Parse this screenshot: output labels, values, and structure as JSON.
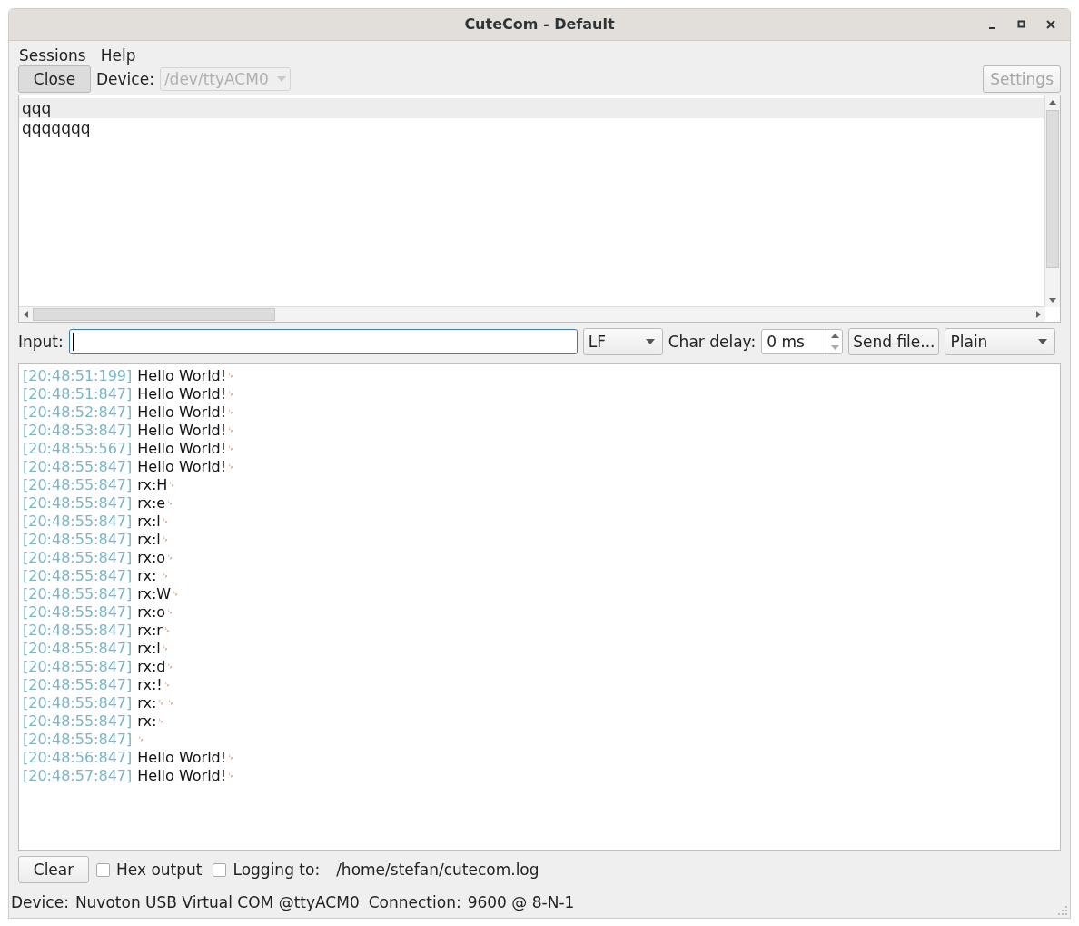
{
  "window": {
    "title": "CuteCom - Default"
  },
  "menu": [
    "Sessions",
    "Help"
  ],
  "toolbar": {
    "close_button": "Close",
    "device_label": "Device:",
    "device": {
      "value": "/dev/ttyACM0",
      "disabled": true
    },
    "settings_button": {
      "label": "Settings",
      "disabled": true
    }
  },
  "history": {
    "lines": [
      {
        "text": "qqq",
        "selected": true
      },
      {
        "text": "qqqqqqq",
        "selected": false
      }
    ]
  },
  "input_bar": {
    "label": "Input:",
    "line_end": "LF",
    "char_delay_label": "Char delay:",
    "char_delay": "0 ms",
    "send_file_button": "Send file...",
    "format": "Plain"
  },
  "log": [
    {
      "time": "[20:48:51:199]",
      "text": "Hello World!",
      "marks": "␊"
    },
    {
      "time": "[20:48:51:847]",
      "text": "Hello World!",
      "marks": "␊"
    },
    {
      "time": "[20:48:52:847]",
      "text": "Hello World!",
      "marks": "␊"
    },
    {
      "time": "[20:48:53:847]",
      "text": "Hello World!",
      "marks": "␊"
    },
    {
      "time": "[20:48:55:567]",
      "text": "Hello World!",
      "marks": "␊"
    },
    {
      "time": "[20:48:55:847]",
      "text": "Hello World!",
      "marks": "␊"
    },
    {
      "time": "[20:48:55:847]",
      "text": "rx:H",
      "marks": "␊"
    },
    {
      "time": "[20:48:55:847]",
      "text": "rx:e",
      "marks": "␊"
    },
    {
      "time": "[20:48:55:847]",
      "text": "rx:l",
      "marks": "␊"
    },
    {
      "time": "[20:48:55:847]",
      "text": "rx:l",
      "marks": "␊"
    },
    {
      "time": "[20:48:55:847]",
      "text": "rx:o",
      "marks": "␊"
    },
    {
      "time": "[20:48:55:847]",
      "text": "rx: ",
      "marks": "␊"
    },
    {
      "time": "[20:48:55:847]",
      "text": "rx:W",
      "marks": "␊"
    },
    {
      "time": "[20:48:55:847]",
      "text": "rx:o",
      "marks": "␊"
    },
    {
      "time": "[20:48:55:847]",
      "text": "rx:r",
      "marks": "␊"
    },
    {
      "time": "[20:48:55:847]",
      "text": "rx:l",
      "marks": "␊"
    },
    {
      "time": "[20:48:55:847]",
      "text": "rx:d",
      "marks": "␊"
    },
    {
      "time": "[20:48:55:847]",
      "text": "rx:!",
      "marks": "␊"
    },
    {
      "time": "[20:48:55:847]",
      "text": "rx:",
      "marks": "␍ ␊"
    },
    {
      "time": "[20:48:55:847]",
      "text": "rx:",
      "marks": "␊"
    },
    {
      "time": "[20:48:55:847]",
      "marks": "␊"
    },
    {
      "time": "[20:48:56:847]",
      "text": "Hello World!",
      "marks": "␊"
    },
    {
      "time": "[20:48:57:847]",
      "text": "Hello World!",
      "marks": "␊"
    }
  ],
  "bottom": {
    "clear_button": "Clear",
    "hex_output": {
      "label": "Hex output",
      "checked": false
    },
    "logging": {
      "label": "Logging to:",
      "checked": false
    },
    "log_path": "/home/stefan/cutecom.log"
  },
  "status_bar": {
    "device_label": "Device:",
    "device": "Nuvoton USB Virtual COM @ttyACM0",
    "connection_label": "Connection:",
    "connection": "9600 @ 8-N-1"
  }
}
